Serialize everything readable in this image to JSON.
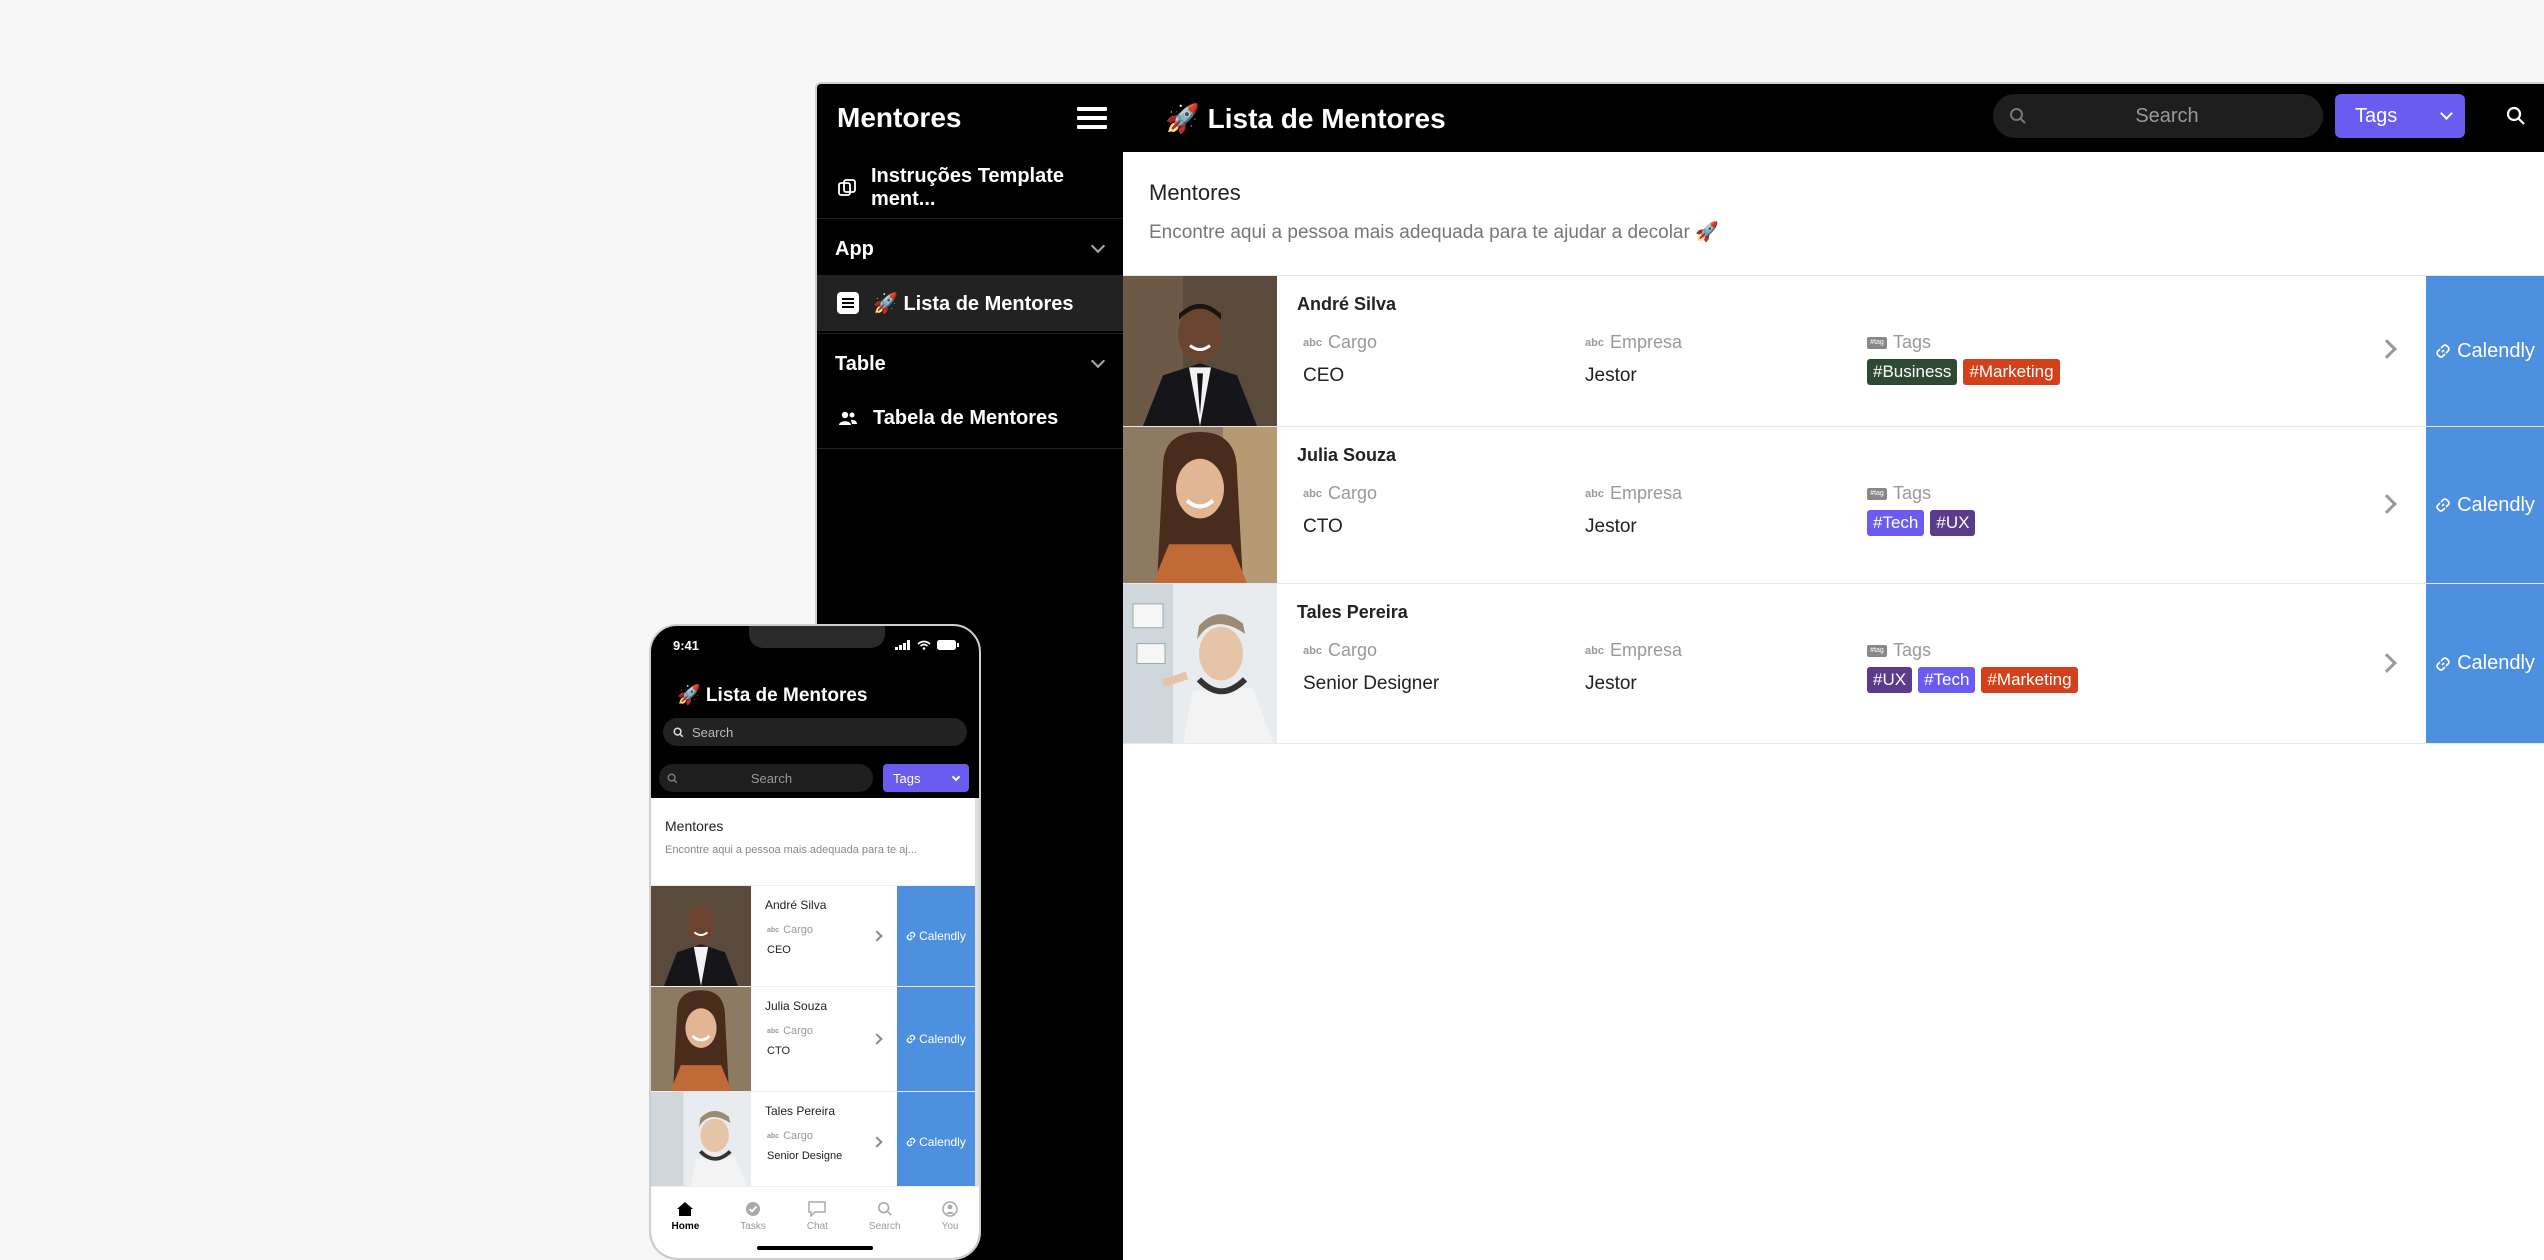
{
  "desktop": {
    "sidebar": {
      "title": "Mentores",
      "top_item": "Instruções Template ment...",
      "sections": [
        {
          "label": "App",
          "items": [
            {
              "label": "🚀 Lista de Mentores"
            }
          ]
        },
        {
          "label": "Table",
          "items": [
            {
              "label": "Tabela de Mentores"
            }
          ]
        }
      ]
    },
    "topbar": {
      "title": "🚀 Lista de Mentores",
      "search_placeholder": "Search",
      "tags_label": "Tags"
    },
    "intro": {
      "title": "Mentores",
      "subtitle": "Encontre aqui a pessoa mais adequada para te ajudar a decolar 🚀"
    },
    "field_labels": {
      "cargo": "Cargo",
      "empresa": "Empresa",
      "tags": "Tags",
      "abc": "abc",
      "tag_icon": "#tag"
    },
    "calendly_label": "Calendly",
    "mentors": [
      {
        "name": "André Silva",
        "cargo": "CEO",
        "empresa": "Jestor",
        "tags": [
          {
            "label": "#Business",
            "color": "#2f4a34"
          },
          {
            "label": "#Marketing",
            "color": "#d2401c"
          }
        ]
      },
      {
        "name": "Julia Souza",
        "cargo": "CTO",
        "empresa": "Jestor",
        "tags": [
          {
            "label": "#Tech",
            "color": "#6b5cf0"
          },
          {
            "label": "#UX",
            "color": "#5a3b8c"
          }
        ]
      },
      {
        "name": "Tales Pereira",
        "cargo": "Senior Designer",
        "empresa": "Jestor",
        "tags": [
          {
            "label": "#UX",
            "color": "#5a3b8c"
          },
          {
            "label": "#Tech",
            "color": "#6b5cf0"
          },
          {
            "label": "#Marketing",
            "color": "#d2401c"
          }
        ]
      }
    ]
  },
  "phone": {
    "time": "9:41",
    "title": "🚀 Lista de Mentores",
    "search_placeholder": "Search",
    "filter_placeholder": "Search",
    "tags_label": "Tags",
    "intro_title": "Mentores",
    "intro_subtitle": "Encontre aqui a pessoa mais adequada para te aj...",
    "cargo_label": "Cargo",
    "calendly_label": "Calendly",
    "mentors": [
      {
        "name": "André Silva",
        "cargo": "CEO"
      },
      {
        "name": "Julia Souza",
        "cargo": "CTO"
      },
      {
        "name": "Tales Pereira",
        "cargo": "Senior Designe"
      }
    ],
    "nav": [
      {
        "label": "Home",
        "icon": "home-icon"
      },
      {
        "label": "Tasks",
        "icon": "check-circle-icon"
      },
      {
        "label": "Chat",
        "icon": "chat-icon"
      },
      {
        "label": "Search",
        "icon": "search-icon"
      },
      {
        "label": "You",
        "icon": "user-icon"
      }
    ]
  },
  "colors": {
    "accent": "#6b5cf0",
    "calendly": "#4d90e0",
    "sidebar": "#000000"
  }
}
